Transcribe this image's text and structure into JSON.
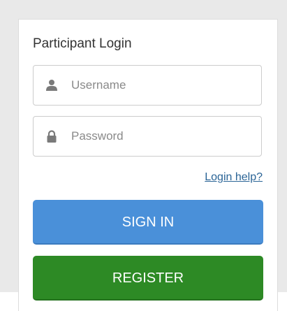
{
  "login": {
    "title": "Participant Login",
    "username": {
      "placeholder": "Username",
      "value": "",
      "icon": "user-icon"
    },
    "password": {
      "placeholder": "Password",
      "value": "",
      "icon": "lock-icon"
    },
    "help_link": "Login help?",
    "sign_in_label": "SIGN IN",
    "register_label": "REGISTER"
  },
  "colors": {
    "sign_in": "#4a90d9",
    "register": "#2d8a25",
    "link": "#2a6496",
    "background": "#e9e9e9"
  }
}
